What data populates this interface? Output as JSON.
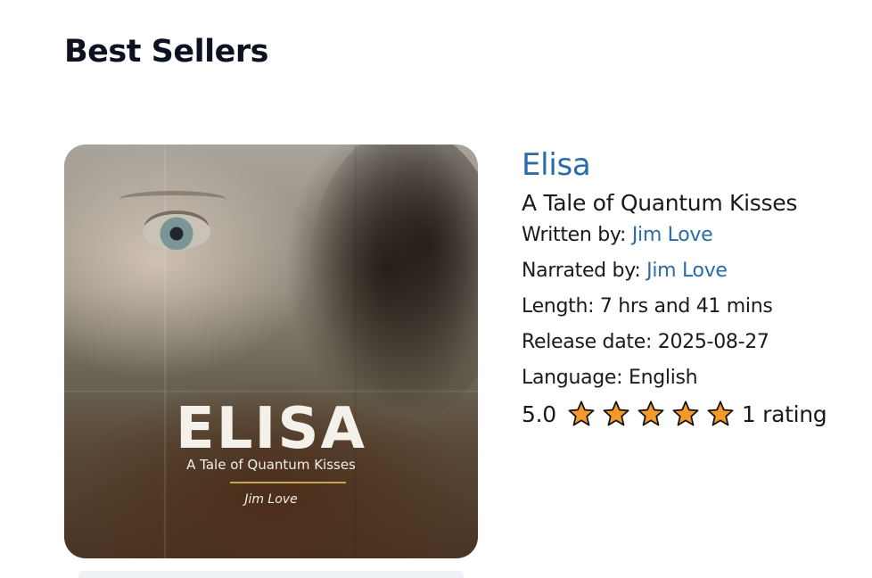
{
  "section": {
    "title": "Best Sellers"
  },
  "cover": {
    "title": "ELISA",
    "subtitle": "A Tale of Quantum Kisses",
    "author": "Jim Love"
  },
  "book": {
    "title": "Elisa",
    "subtitle": "A Tale of Quantum Kisses",
    "written_by_label": "Written by:",
    "author": "Jim Love",
    "narrated_by_label": "Narrated by:",
    "narrator": "Jim Love",
    "length_text": "Length: 7 hrs and 41 mins",
    "release_text": "Release date: 2025-08-27",
    "language_text": "Language: English",
    "rating_value": "5.0",
    "stars_filled": 5,
    "stars_total": 5,
    "rating_count": "1 rating"
  },
  "colors": {
    "link": "#2a6ba9",
    "star_fill": "#f39a2b",
    "star_stroke": "#111111"
  },
  "icons": {
    "star": "star-icon"
  }
}
